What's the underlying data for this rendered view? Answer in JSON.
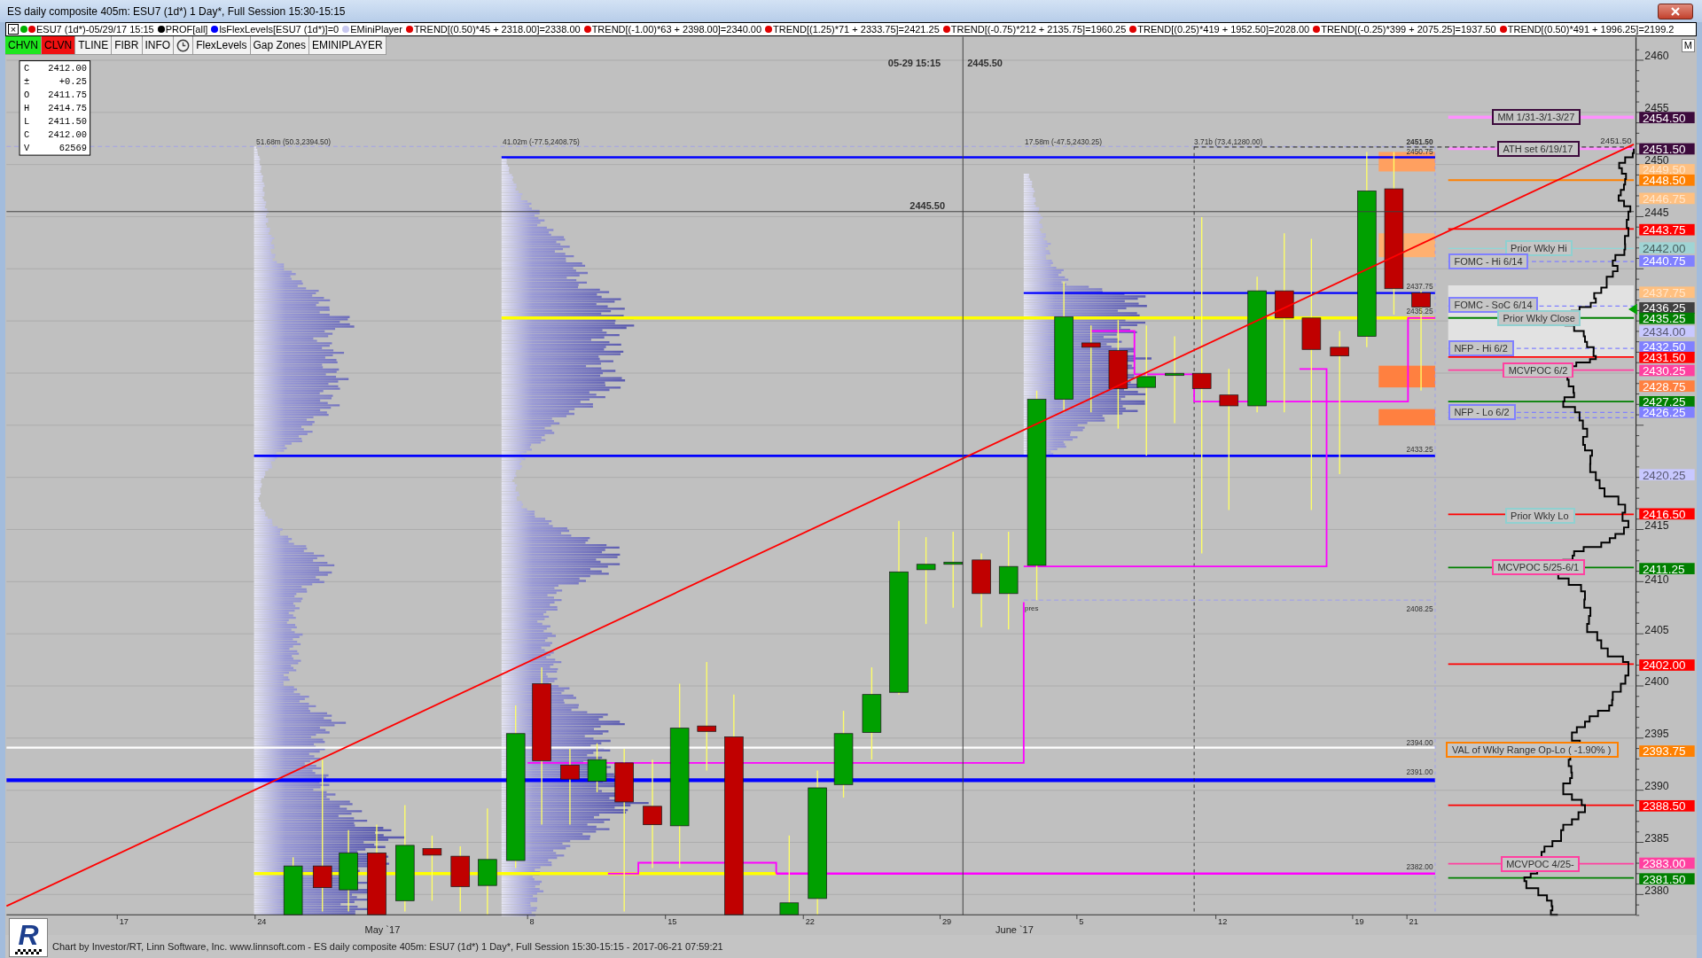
{
  "window": {
    "title": "ES daily composite 405m: ESU7 (1d*) 1 Day*, Full Session 15:30-15:15"
  },
  "indicator_strip": {
    "close": "×",
    "items": [
      {
        "dots": [
          {
            "color": "#00b000"
          },
          {
            "color": "#e00000"
          }
        ],
        "label": "ESU7 (1d*)-05/29/17 15:15"
      },
      {
        "dots": [
          {
            "color": "#000000"
          }
        ],
        "label": "PROF[all]"
      },
      {
        "dots": [
          {
            "color": "#0000ff"
          }
        ],
        "label": "lsFlexLevels[ESU7 (1d*)]=0"
      },
      {
        "dots": [
          {
            "color": "#c8c8f0"
          }
        ],
        "label": "EMiniPlayer"
      },
      {
        "dots": [
          {
            "color": "#e00000"
          }
        ],
        "label": "TREND[(0.50)*45 + 2318.00]=2338.00"
      },
      {
        "dots": [
          {
            "color": "#e00000"
          }
        ],
        "label": "TREND[(-1.00)*63 + 2398.00]=2340.00"
      },
      {
        "dots": [
          {
            "color": "#e00000"
          }
        ],
        "label": "TREND[(1.25)*71 + 2333.75]=2421.25"
      },
      {
        "dots": [
          {
            "color": "#e00000"
          }
        ],
        "label": "TREND[(-0.75)*212 + 2135.75]=1960.25"
      },
      {
        "dots": [
          {
            "color": "#e00000"
          }
        ],
        "label": "TREND[(0.25)*419 + 1952.50]=2028.00"
      },
      {
        "dots": [
          {
            "color": "#e00000"
          }
        ],
        "label": "TREND[(-0.25)*399 + 2075.25]=1937.50"
      },
      {
        "dots": [
          {
            "color": "#e00000"
          }
        ],
        "label": "TREND[(0.50)*491 + 1996.25]=2199.2"
      }
    ]
  },
  "toolbar": {
    "buttons": [
      {
        "kind": "text",
        "label": "CHVN",
        "color": "#1ee61e"
      },
      {
        "kind": "text",
        "label": "CLVN",
        "color": "#f01010"
      },
      {
        "kind": "text",
        "label": "TLINE"
      },
      {
        "kind": "text",
        "label": "FIBR"
      },
      {
        "kind": "text",
        "label": "INFO"
      },
      {
        "kind": "clock"
      },
      {
        "kind": "text",
        "label": "FlexLevels"
      },
      {
        "kind": "text",
        "label": "Gap Zones"
      },
      {
        "kind": "text",
        "label": "EMINIPLAYER"
      }
    ],
    "corner_button": "M"
  },
  "chart": {
    "crosshair": {
      "time": "05-29 15:15",
      "price": "2445.50",
      "price_label": "2445.50"
    },
    "ohlc": [
      {
        "key": "C",
        "value": "2412.00"
      },
      {
        "key": "±",
        "value": "+0.25"
      },
      {
        "key": "O",
        "value": "2411.75"
      },
      {
        "key": "H",
        "value": "2414.75"
      },
      {
        "key": "L",
        "value": "2411.50"
      },
      {
        "key": "C",
        "value": "2412.00"
      },
      {
        "key": "V",
        "value": "62569"
      }
    ],
    "profile_labels": [
      "51.68m (50.3,2394.50)",
      "41.02m (-77.5,2408.75)",
      "17.58m (-47.5,2430.25)",
      "3.71b (73.4,1280.00)"
    ],
    "price_notes": [
      "2451.50",
      "2450.75",
      "2437.75",
      "2435.25",
      "2433.25",
      "2408.25",
      "2394.00",
      "2391.00",
      "2382.00"
    ],
    "session_note": "pres",
    "line_note": "2451.50",
    "level_labels": [
      {
        "text": "MM 1/31-3/1-3/27",
        "color": "#3c0a3c"
      },
      {
        "text": "ATH set 6/19/17",
        "color": "#3c0a3c"
      },
      {
        "text": "Prior Wkly Hi",
        "color": "#90d0d0"
      },
      {
        "text": "FOMC - Hi 6/14",
        "color": "#8080ff"
      },
      {
        "text": "FOMC - SoC 6/14",
        "color": "#8080ff"
      },
      {
        "text": "Prior Wkly Close",
        "color": "#90d0d0"
      },
      {
        "text": "NFP - Hi 6/2",
        "color": "#8080ff"
      },
      {
        "text": "MCVPOC 6/2",
        "color": "#ff40a0"
      },
      {
        "text": "NFP - Lo 6/2",
        "color": "#8080ff"
      },
      {
        "text": "Prior Wkly Lo",
        "color": "#90d0d0"
      },
      {
        "text": "MCVPOC 5/25-6/1",
        "color": "#ff40a0"
      },
      {
        "text": "VAL of Wkly Range Op-Lo ( -1.90% )",
        "color": "#ff8000"
      },
      {
        "text": "MCVPOC 4/25-",
        "color": "#ff40a0"
      }
    ],
    "price_ticks": [
      "2460",
      "2455",
      "2450",
      "2445",
      "2415",
      "2410",
      "2405",
      "2400",
      "2395",
      "2390",
      "2385",
      "2380"
    ],
    "price_tags": [
      {
        "text": "2454.50",
        "color": "#3c0a3c"
      },
      {
        "text": "2451.50",
        "color": "#3c0a3c"
      },
      {
        "text": "2449.50",
        "color": "#ffc080"
      },
      {
        "text": "2448.50",
        "color": "#ff8000"
      },
      {
        "text": "2446.75",
        "color": "#ffc080"
      },
      {
        "text": "2443.75",
        "color": "#ff0000"
      },
      {
        "text": "2442.00",
        "color": "#a0d4d4"
      },
      {
        "text": "2440.75",
        "color": "#8080ff"
      },
      {
        "text": "2437.75",
        "color": "#ffc080"
      },
      {
        "text": "2436.25",
        "color": "#404040"
      },
      {
        "text": "2435.25",
        "color": "#008000"
      },
      {
        "text": "2434.00",
        "color": "#c8c8ff"
      },
      {
        "text": "2432.50",
        "color": "#8080ff"
      },
      {
        "text": "2431.50",
        "color": "#ff0000"
      },
      {
        "text": "2430.25",
        "color": "#ff40a0"
      },
      {
        "text": "2428.75",
        "color": "#ff8040"
      },
      {
        "text": "2427.25",
        "color": "#008000"
      },
      {
        "text": "2426.25",
        "color": "#8080ff"
      },
      {
        "text": "2420.25",
        "color": "#c8c8ff"
      },
      {
        "text": "2416.50",
        "color": "#ff0000"
      },
      {
        "text": "2411.25",
        "color": "#008000"
      },
      {
        "text": "2402.00",
        "color": "#ff0000"
      },
      {
        "text": "2393.75",
        "color": "#ff8000"
      },
      {
        "text": "2388.50",
        "color": "#ff0000"
      },
      {
        "text": "2383.00",
        "color": "#ff40a0"
      },
      {
        "text": "2381.50",
        "color": "#008000"
      }
    ],
    "day_ticks": [
      "17",
      "24",
      "8",
      "15",
      "22",
      "29",
      "5",
      "12",
      "19",
      "21"
    ],
    "month_labels": [
      "May `17",
      "June `17"
    ]
  },
  "status_bar": {
    "logo": "R",
    "text": "Chart by Investor/RT, Linn Software, Inc. www.linnsoft.com - ES daily composite 405m: ESU7 (1d*) 1 Day*, Full Session 15:30-15:15 - 2017-06-21 07:59:21"
  }
}
